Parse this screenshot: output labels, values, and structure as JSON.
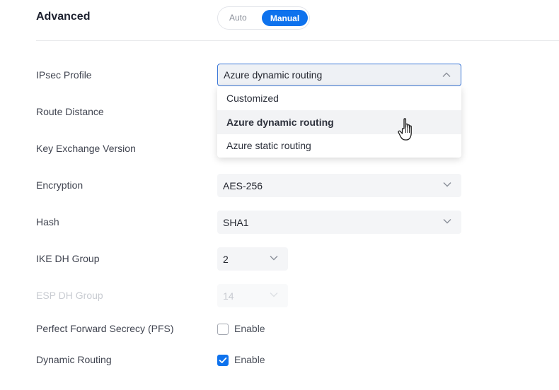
{
  "section": {
    "title": "Advanced",
    "mode_toggle": {
      "options": [
        "Auto",
        "Manual"
      ],
      "selected": "Manual"
    }
  },
  "fields": {
    "ipsec_profile": {
      "label": "IPsec Profile",
      "value": "Azure dynamic routing",
      "open": true
    },
    "route_distance": {
      "label": "Route Distance"
    },
    "key_exchange_version": {
      "label": "Key Exchange Version"
    },
    "encryption": {
      "label": "Encryption",
      "value": "AES-256"
    },
    "hash": {
      "label": "Hash",
      "value": "SHA1"
    },
    "ike_dh_group": {
      "label": "IKE DH Group",
      "value": "2"
    },
    "esp_dh_group": {
      "label": "ESP DH Group",
      "value": "14",
      "disabled": true
    },
    "pfs": {
      "label": "Perfect Forward Secrecy (PFS)",
      "checkbox_label": "Enable",
      "checked": false
    },
    "dynamic_routing": {
      "label": "Dynamic Routing",
      "checkbox_label": "Enable",
      "checked": true
    }
  },
  "dropdown": {
    "options": [
      "Customized",
      "Azure dynamic routing",
      "Azure static routing"
    ],
    "hovered": "Azure dynamic routing"
  },
  "icons": {
    "chevron_up": "chevron-up-icon",
    "chevron_down": "chevron-down-icon",
    "checkmark": "checkmark-icon",
    "cursor": "hand-pointer-icon"
  },
  "colors": {
    "accent": "#0e72ed",
    "focus_border": "#3c78d8"
  }
}
